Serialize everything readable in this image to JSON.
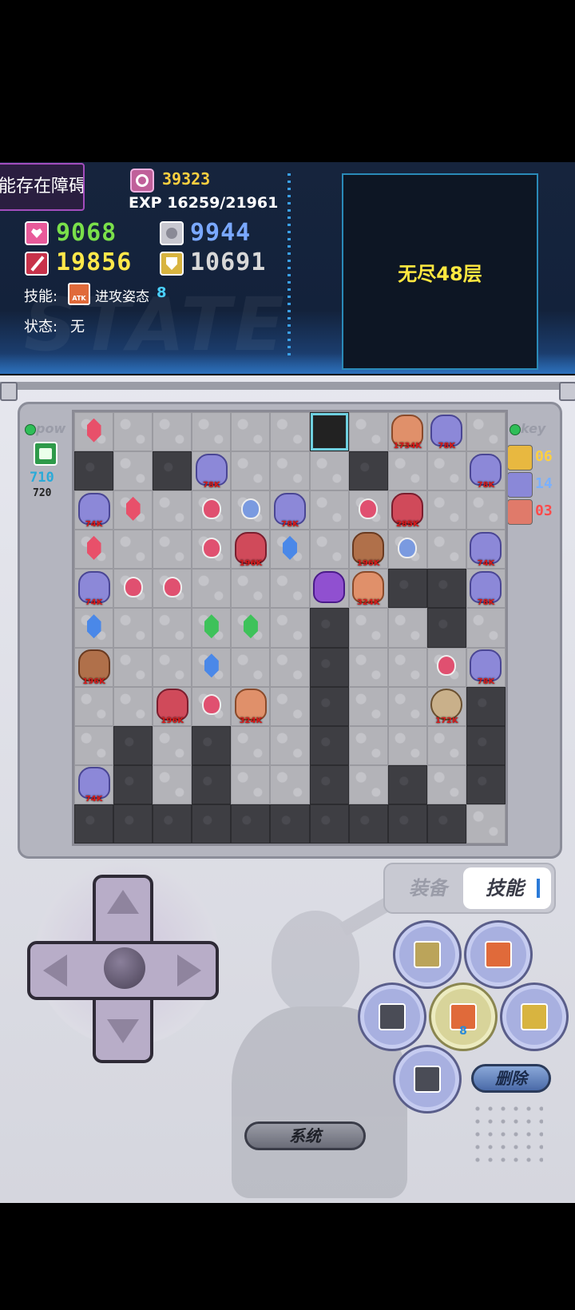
{
  "hud": {
    "tip_badge": "能存在障碍",
    "gold": "39323",
    "exp_label": "EXP",
    "exp_value": "16259/21961",
    "hp": "9068",
    "mdef": "9944",
    "atk": "19856",
    "def": "10691",
    "skill_label": "技能:",
    "skill_name": "进攻姿态",
    "skill_level": "8",
    "state_label": "状态:",
    "state_value": "无",
    "floor_name": "无尽48层",
    "watermark": "STATE"
  },
  "left_panel": {
    "pow_label": "pow",
    "pow_value": "710",
    "pow_max": "720"
  },
  "right_panel": {
    "key_label": "key",
    "keys": [
      {
        "color": "#e8b840",
        "count": "06",
        "num_color": "#ffd040"
      },
      {
        "color": "#8a88d8",
        "count": "14",
        "num_color": "#7ab0ff"
      },
      {
        "color": "#e07a6a",
        "count": "03",
        "num_color": "#ff4a4a"
      }
    ]
  },
  "board": {
    "rows": [
      "WGFFFFDFWMM",
      "WFWMFFFWFFM",
      "MGFPPMFPMFM",
      "GFFPMBFMPFM",
      "MPPFFFHMWWM",
      "BFFGGFWFFWF",
      "MFFFBFWFFPM",
      "FFMPMFWFFMW",
      "FWFWFFWFFFW",
      "MWFWFFWFWFW",
      "WWWWWWWWWWF"
    ],
    "entities": [
      {
        "r": 0,
        "c": 0,
        "kind": "gem",
        "variant": "red"
      },
      {
        "r": 0,
        "c": 8,
        "kind": "monster",
        "variant": "m-flesh",
        "dmg": "1734K"
      },
      {
        "r": 0,
        "c": 9,
        "kind": "monster",
        "variant": "m-blue",
        "dmg": "78K"
      },
      {
        "r": 1,
        "c": 3,
        "kind": "monster",
        "variant": "m-blue",
        "dmg": "78K"
      },
      {
        "r": 1,
        "c": 10,
        "kind": "monster",
        "variant": "m-blue",
        "dmg": "78K"
      },
      {
        "r": 2,
        "c": 0,
        "kind": "monster",
        "variant": "m-blue",
        "dmg": "74K"
      },
      {
        "r": 2,
        "c": 1,
        "kind": "gem",
        "variant": "red"
      },
      {
        "r": 2,
        "c": 3,
        "kind": "potion",
        "variant": ""
      },
      {
        "r": 2,
        "c": 4,
        "kind": "potion",
        "variant": "blue"
      },
      {
        "r": 2,
        "c": 5,
        "kind": "monster",
        "variant": "m-blue",
        "dmg": "78K"
      },
      {
        "r": 2,
        "c": 7,
        "kind": "potion",
        "variant": ""
      },
      {
        "r": 2,
        "c": 8,
        "kind": "monster",
        "variant": "m-red",
        "dmg": "285K"
      },
      {
        "r": 3,
        "c": 0,
        "kind": "gem",
        "variant": "red"
      },
      {
        "r": 3,
        "c": 3,
        "kind": "potion",
        "variant": ""
      },
      {
        "r": 3,
        "c": 4,
        "kind": "monster",
        "variant": "m-red",
        "dmg": "196K"
      },
      {
        "r": 3,
        "c": 5,
        "kind": "gem",
        "variant": "blue"
      },
      {
        "r": 3,
        "c": 7,
        "kind": "monster",
        "variant": "m-brown",
        "dmg": "196K"
      },
      {
        "r": 3,
        "c": 8,
        "kind": "potion",
        "variant": "blue"
      },
      {
        "r": 3,
        "c": 10,
        "kind": "monster",
        "variant": "m-blue",
        "dmg": "74K"
      },
      {
        "r": 4,
        "c": 0,
        "kind": "monster",
        "variant": "m-blue",
        "dmg": "74K"
      },
      {
        "r": 4,
        "c": 1,
        "kind": "potion",
        "variant": ""
      },
      {
        "r": 4,
        "c": 2,
        "kind": "potion",
        "variant": ""
      },
      {
        "r": 4,
        "c": 6,
        "kind": "monster",
        "variant": "m-purple",
        "dmg": ""
      },
      {
        "r": 4,
        "c": 7,
        "kind": "monster",
        "variant": "m-flesh",
        "dmg": "324K"
      },
      {
        "r": 4,
        "c": 10,
        "kind": "monster",
        "variant": "m-blue",
        "dmg": "78K"
      },
      {
        "r": 5,
        "c": 0,
        "kind": "gem",
        "variant": "blue"
      },
      {
        "r": 5,
        "c": 3,
        "kind": "gem",
        "variant": "green"
      },
      {
        "r": 5,
        "c": 4,
        "kind": "gem",
        "variant": "green"
      },
      {
        "r": 6,
        "c": 0,
        "kind": "monster",
        "variant": "m-brown",
        "dmg": "196K"
      },
      {
        "r": 6,
        "c": 3,
        "kind": "gem",
        "variant": "blue"
      },
      {
        "r": 6,
        "c": 9,
        "kind": "potion",
        "variant": ""
      },
      {
        "r": 6,
        "c": 10,
        "kind": "monster",
        "variant": "m-blue",
        "dmg": "78K"
      },
      {
        "r": 7,
        "c": 2,
        "kind": "monster",
        "variant": "m-red",
        "dmg": "196K"
      },
      {
        "r": 7,
        "c": 3,
        "kind": "potion",
        "variant": ""
      },
      {
        "r": 7,
        "c": 4,
        "kind": "monster",
        "variant": "m-flesh",
        "dmg": "324K"
      },
      {
        "r": 7,
        "c": 9,
        "kind": "monster",
        "variant": "m-skel",
        "dmg": "172K"
      },
      {
        "r": 9,
        "c": 0,
        "kind": "monster",
        "variant": "m-blue",
        "dmg": "74K"
      }
    ]
  },
  "controls": {
    "tab_equip": "装备",
    "tab_skill": "技能",
    "skill8_level": "8",
    "delete_label": "删除",
    "system_label": "系统"
  },
  "colors": {
    "hp": "#7ae04a",
    "mdef": "#7aa8ff",
    "atk": "#ffe84a",
    "def": "#d8d8d8",
    "gold": "#ffd040",
    "floor": "#ffe840"
  }
}
